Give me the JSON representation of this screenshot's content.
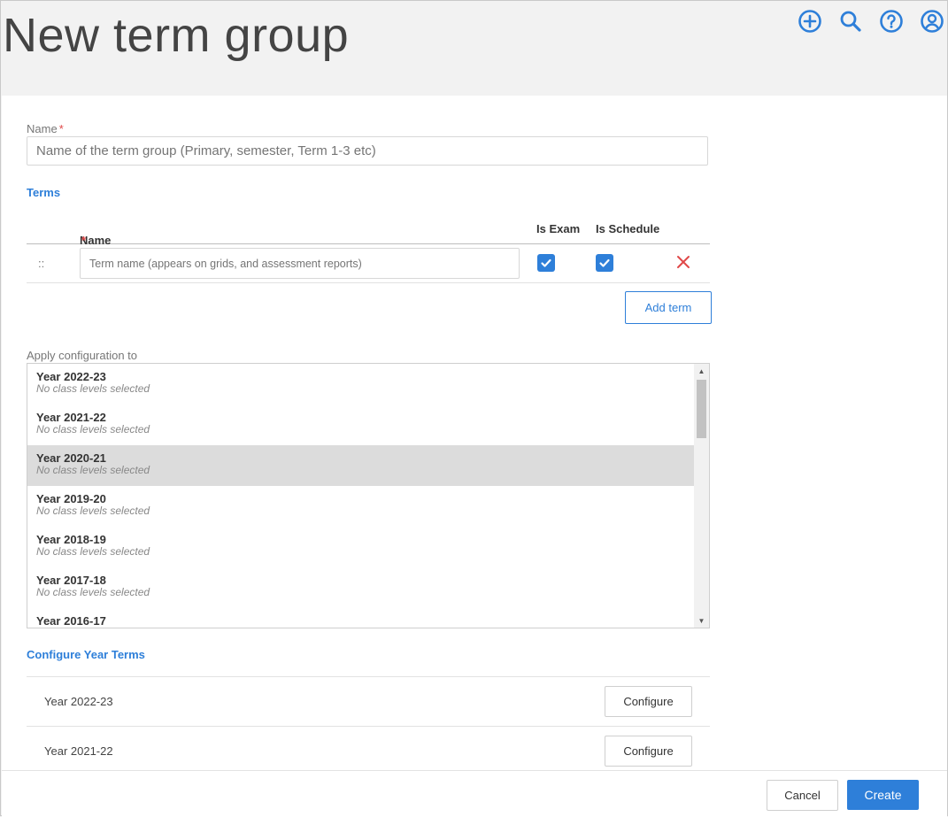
{
  "header": {
    "title": "New term group",
    "icons": [
      "add-circle-icon",
      "search-icon",
      "help-icon",
      "account-icon"
    ]
  },
  "form": {
    "name_label": "Name",
    "required_mark": "*",
    "name_placeholder": "Name of the term group (Primary, semester, Term 1-3 etc)"
  },
  "terms": {
    "section_title": "Terms",
    "columns": {
      "name": "Name",
      "is_exam": "Is Exam",
      "is_schedule": "Is Schedule"
    },
    "row": {
      "drag_handle": "::",
      "name_placeholder": "Term name (appears on grids, and assessment reports)",
      "is_exam": true,
      "is_schedule": true
    },
    "add_term_label": "Add term"
  },
  "apply": {
    "label": "Apply configuration to",
    "items": [
      {
        "title": "Year 2022-23",
        "subtitle": "No class levels selected"
      },
      {
        "title": "Year 2021-22",
        "subtitle": "No class levels selected"
      },
      {
        "title": "Year 2020-21",
        "subtitle": "No class levels selected"
      },
      {
        "title": "Year 2019-20",
        "subtitle": "No class levels selected"
      },
      {
        "title": "Year 2018-19",
        "subtitle": "No class levels selected"
      },
      {
        "title": "Year 2017-18",
        "subtitle": "No class levels selected"
      },
      {
        "title": "Year 2016-17",
        "subtitle": ""
      }
    ],
    "selected_item": "Year 2020-21"
  },
  "configure": {
    "section_title": "Configure Year Terms",
    "rows": [
      {
        "year": "Year 2022-23",
        "button": "Configure"
      },
      {
        "year": "Year 2021-22",
        "button": "Configure"
      }
    ]
  },
  "footer": {
    "cancel_label": "Cancel",
    "create_label": "Create"
  },
  "colors": {
    "accent": "#2e7fd9",
    "required": "#e04848",
    "header_bg": "#f2f2f2",
    "selected_row": "#dcdcdc"
  }
}
